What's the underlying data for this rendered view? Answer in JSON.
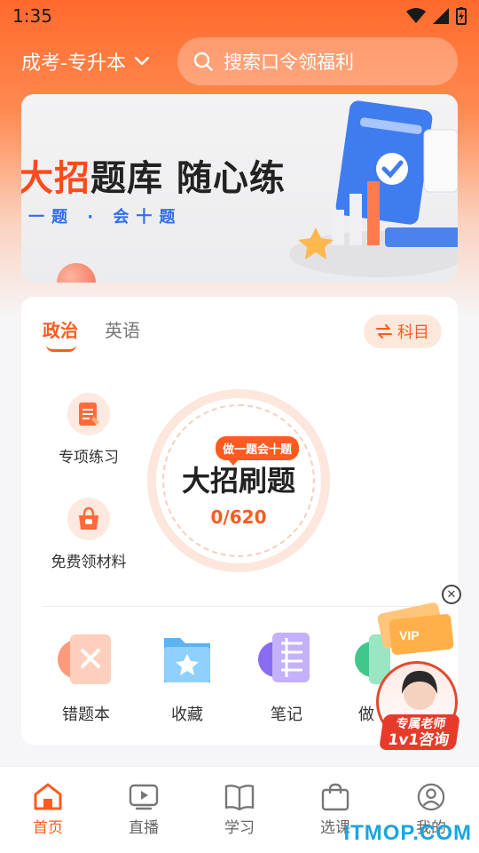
{
  "status_bar": {
    "time": "1:35"
  },
  "header": {
    "exam_selector": "成考-专升本",
    "search_placeholder": "搜索口令领福利"
  },
  "banner": {
    "title_highlight": "大招",
    "title_rest": "题库 随心练",
    "subtitle": "一题 · 会十题"
  },
  "main": {
    "tabs": [
      {
        "label": "政治",
        "active": true
      },
      {
        "label": "英语",
        "active": false
      }
    ],
    "subject_button": "科目",
    "side_items": [
      {
        "label": "专项练习",
        "icon": "quiz-doc-icon"
      },
      {
        "label": "免费领材料",
        "icon": "gift-bag-icon"
      }
    ],
    "practice": {
      "bubble": "做一题会十题",
      "title": "大招刷题",
      "progress": "0/620"
    },
    "tools": [
      {
        "label": "错题本",
        "icon": "wrong-book-icon"
      },
      {
        "label": "收藏",
        "icon": "star-folder-icon"
      },
      {
        "label": "笔记",
        "icon": "notes-icon"
      },
      {
        "label": "做",
        "icon": "practice-icon"
      }
    ]
  },
  "advisor": {
    "line1": "专属老师",
    "line2": "1v1咨询"
  },
  "bottom_nav": [
    {
      "label": "首页",
      "icon": "home-icon",
      "active": true
    },
    {
      "label": "直播",
      "icon": "live-icon",
      "active": false
    },
    {
      "label": "学习",
      "icon": "book-icon",
      "active": false
    },
    {
      "label": "选课",
      "icon": "shopping-bag-icon",
      "active": false
    },
    {
      "label": "我的",
      "icon": "profile-icon",
      "active": false
    }
  ],
  "watermark": "ITMOP.COM",
  "colors": {
    "accent": "#ff5a1f",
    "header_gradient_top": "#ff6a2b"
  }
}
